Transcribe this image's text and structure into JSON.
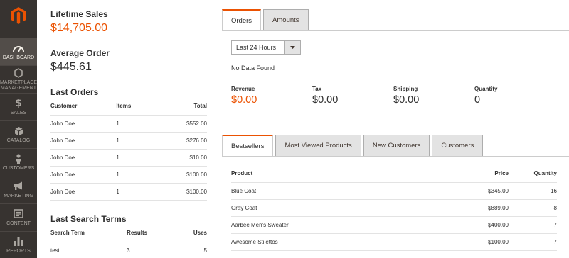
{
  "sidebar": {
    "items": [
      {
        "label": "Dashboard",
        "icon": "dashboard-icon",
        "active": true
      },
      {
        "label": "Marketplace Management",
        "icon": "hexagon-icon",
        "active": false
      },
      {
        "label": "Sales",
        "icon": "dollar-icon",
        "active": false
      },
      {
        "label": "Catalog",
        "icon": "box-icon",
        "active": false
      },
      {
        "label": "Customers",
        "icon": "person-icon",
        "active": false
      },
      {
        "label": "Marketing",
        "icon": "megaphone-icon",
        "active": false
      },
      {
        "label": "Content",
        "icon": "content-icon",
        "active": false
      },
      {
        "label": "Reports",
        "icon": "bar-chart-icon",
        "active": false
      }
    ],
    "dollar_glyph": "$",
    "colors": {
      "background": "#373330",
      "active": "#524d49",
      "logo": "#eb5202"
    }
  },
  "lifetime_sales": {
    "label": "Lifetime Sales",
    "value": "$14,705.00"
  },
  "average_order": {
    "label": "Average Order",
    "value": "$445.61"
  },
  "last_orders": {
    "title": "Last Orders",
    "headers": {
      "customer": "Customer",
      "items": "Items",
      "total": "Total"
    },
    "rows": [
      {
        "customer": "John Doe",
        "items": "1",
        "total": "$552.00"
      },
      {
        "customer": "John Doe",
        "items": "1",
        "total": "$276.00"
      },
      {
        "customer": "John Doe",
        "items": "1",
        "total": "$10.00"
      },
      {
        "customer": "John Doe",
        "items": "1",
        "total": "$100.00"
      },
      {
        "customer": "John Doe",
        "items": "1",
        "total": "$100.00"
      }
    ]
  },
  "last_search_terms": {
    "title": "Last Search Terms",
    "headers": {
      "term": "Search Term",
      "results": "Results",
      "uses": "Uses"
    },
    "rows": [
      {
        "term": "test",
        "results": "3",
        "uses": "5"
      }
    ]
  },
  "chart_tabs": {
    "orders": "Orders",
    "amounts": "Amounts"
  },
  "period_select": {
    "value": "Last 24 Hours"
  },
  "no_data": "No Data Found",
  "totals": {
    "revenue": {
      "label": "Revenue",
      "value": "$0.00"
    },
    "tax": {
      "label": "Tax",
      "value": "$0.00"
    },
    "shipping": {
      "label": "Shipping",
      "value": "$0.00"
    },
    "quantity": {
      "label": "Quantity",
      "value": "0"
    }
  },
  "grid_tabs": {
    "bestsellers": "Bestsellers",
    "most_viewed": "Most Viewed Products",
    "new_customers": "New Customers",
    "customers": "Customers"
  },
  "bestsellers": {
    "headers": {
      "product": "Product",
      "price": "Price",
      "quantity": "Quantity"
    },
    "rows": [
      {
        "product": "Blue Coat",
        "price": "$345.00",
        "quantity": "16"
      },
      {
        "product": "Gray Coat",
        "price": "$889.00",
        "quantity": "8"
      },
      {
        "product": "Aarbee Men's Sweater",
        "price": "$400.00",
        "quantity": "7"
      },
      {
        "product": "Awesome Stilettos",
        "price": "$100.00",
        "quantity": "7"
      }
    ]
  },
  "accent_color": "#eb5202"
}
